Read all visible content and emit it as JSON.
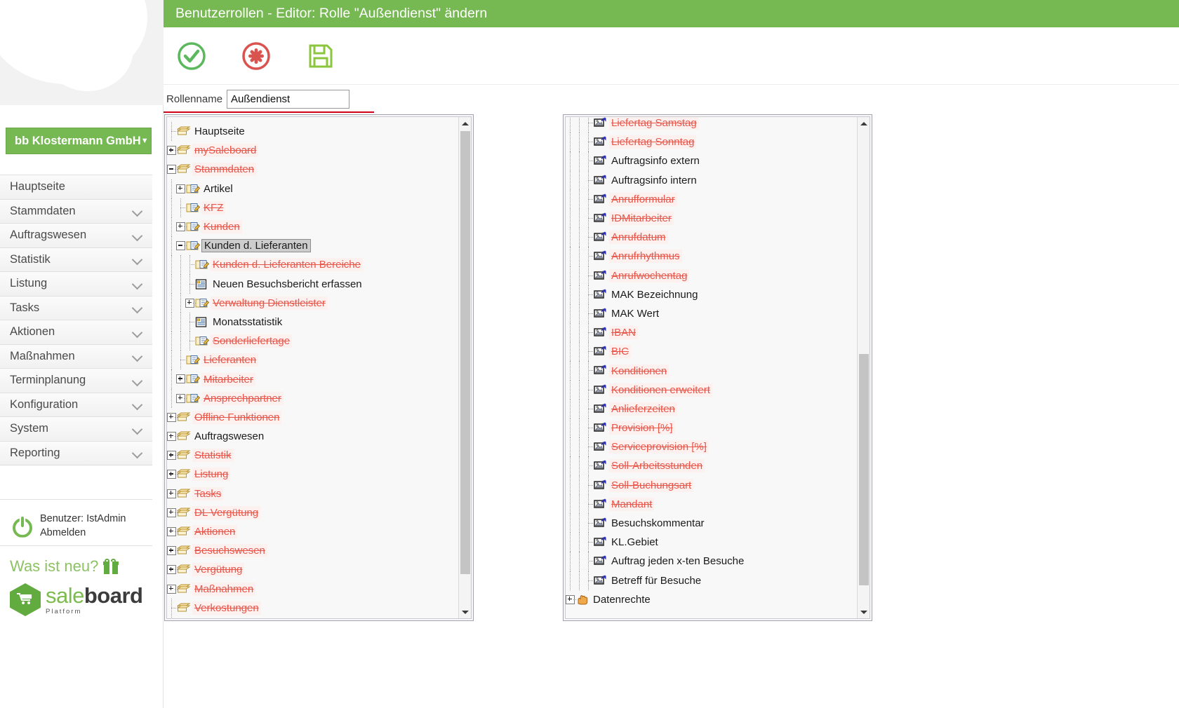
{
  "titlebar": {
    "title": "Benutzerrollen - Editor: Rolle \"Außendienst\" ändern"
  },
  "toolbar": {
    "ok_label": "check-circle",
    "cancel_label": "cancel-circle",
    "save_label": "floppy-disk"
  },
  "form": {
    "rolename_label": "Rollenname",
    "rolename_value": "Außendienst",
    "rolename_placeholder": ""
  },
  "sidebar": {
    "company": "bb Klostermann GmbH",
    "caret": "▼",
    "items": [
      {
        "label": "Hauptseite",
        "has_chevron": false
      },
      {
        "label": "Stammdaten",
        "has_chevron": true
      },
      {
        "label": "Auftragswesen",
        "has_chevron": true
      },
      {
        "label": "Statistik",
        "has_chevron": true
      },
      {
        "label": "Listung",
        "has_chevron": true
      },
      {
        "label": "Tasks",
        "has_chevron": true
      },
      {
        "label": "Aktionen",
        "has_chevron": true
      },
      {
        "label": "Maßnahmen",
        "has_chevron": true
      },
      {
        "label": "Terminplanung",
        "has_chevron": true
      },
      {
        "label": "Konfiguration",
        "has_chevron": true
      },
      {
        "label": "System",
        "has_chevron": true
      },
      {
        "label": "Reporting",
        "has_chevron": true
      }
    ],
    "user_line1": "Benutzer: IstAdmin",
    "user_line2": "Abmelden",
    "news_label": "Was ist neu?",
    "logo_sale": "sale",
    "logo_board": "board",
    "logo_sub": "Platform"
  },
  "left_tree": {
    "nodes": [
      {
        "label": "Hauptseite",
        "depth": 0,
        "exp": "none",
        "icon": "folder-stack",
        "denied": false,
        "selected": false
      },
      {
        "label": "mySaleboard",
        "depth": 0,
        "exp": "plus",
        "icon": "folder-stack",
        "denied": true,
        "selected": false
      },
      {
        "label": "Stammdaten",
        "depth": 0,
        "exp": "minus",
        "icon": "folder-stack",
        "denied": true,
        "selected": false
      },
      {
        "label": "Artikel",
        "depth": 1,
        "exp": "plus",
        "icon": "folder-page",
        "denied": false,
        "selected": false
      },
      {
        "label": "KFZ",
        "depth": 1,
        "exp": "none",
        "icon": "folder-page",
        "denied": true,
        "selected": false
      },
      {
        "label": "Kunden",
        "depth": 1,
        "exp": "plus",
        "icon": "folder-page",
        "denied": true,
        "selected": false
      },
      {
        "label": "Kunden d. Lieferanten",
        "depth": 1,
        "exp": "minus",
        "icon": "folder-page",
        "denied": false,
        "selected": true
      },
      {
        "label": "Kunden d. Lieferanten Bereiche",
        "depth": 2,
        "exp": "none",
        "icon": "folder-page",
        "denied": true,
        "selected": false
      },
      {
        "label": "Neuen Besuchsbericht erfassen",
        "depth": 2,
        "exp": "none",
        "icon": "form",
        "denied": false,
        "selected": false
      },
      {
        "label": "Verwaltung Dienstleister",
        "depth": 2,
        "exp": "plus",
        "icon": "folder-page",
        "denied": true,
        "selected": false
      },
      {
        "label": "Monatsstatistik",
        "depth": 2,
        "exp": "none",
        "icon": "form",
        "denied": false,
        "selected": false
      },
      {
        "label": "Sonderliefertage",
        "depth": 2,
        "exp": "none",
        "icon": "folder-page",
        "denied": true,
        "selected": false
      },
      {
        "label": "Lieferanten",
        "depth": 1,
        "exp": "none",
        "icon": "folder-page",
        "denied": true,
        "selected": false
      },
      {
        "label": "Mitarbeiter",
        "depth": 1,
        "exp": "plus",
        "icon": "folder-page",
        "denied": true,
        "selected": false
      },
      {
        "label": "Ansprechpartner",
        "depth": 1,
        "exp": "plus",
        "icon": "folder-page",
        "denied": true,
        "selected": false
      },
      {
        "label": "Offline Funktionen",
        "depth": 0,
        "exp": "plus",
        "icon": "folder-stack",
        "denied": true,
        "selected": false
      },
      {
        "label": "Auftragswesen",
        "depth": 0,
        "exp": "plus",
        "icon": "folder-stack",
        "denied": false,
        "selected": false
      },
      {
        "label": "Statistik",
        "depth": 0,
        "exp": "plus",
        "icon": "folder-stack",
        "denied": true,
        "selected": false
      },
      {
        "label": "Listung",
        "depth": 0,
        "exp": "plus",
        "icon": "folder-stack",
        "denied": true,
        "selected": false
      },
      {
        "label": "Tasks",
        "depth": 0,
        "exp": "plus",
        "icon": "folder-stack",
        "denied": true,
        "selected": false
      },
      {
        "label": "DL Vergütung",
        "depth": 0,
        "exp": "plus",
        "icon": "folder-stack",
        "denied": true,
        "selected": false
      },
      {
        "label": "Aktionen",
        "depth": 0,
        "exp": "plus",
        "icon": "folder-stack",
        "denied": true,
        "selected": false
      },
      {
        "label": "Besuchswesen",
        "depth": 0,
        "exp": "plus",
        "icon": "folder-stack",
        "denied": true,
        "selected": false
      },
      {
        "label": "Vergütung",
        "depth": 0,
        "exp": "plus",
        "icon": "folder-stack",
        "denied": true,
        "selected": false
      },
      {
        "label": "Maßnahmen",
        "depth": 0,
        "exp": "plus",
        "icon": "folder-stack",
        "denied": true,
        "selected": false
      },
      {
        "label": "Verkostungen",
        "depth": 0,
        "exp": "none",
        "icon": "folder-stack",
        "denied": true,
        "selected": false
      }
    ]
  },
  "right_tree": {
    "nodes": [
      {
        "label": "Liefertag Samstag",
        "depth": 2,
        "exp": "none",
        "icon": "property",
        "denied": true
      },
      {
        "label": "Liefertag Sonntag",
        "depth": 2,
        "exp": "none",
        "icon": "property",
        "denied": true
      },
      {
        "label": "Auftragsinfo extern",
        "depth": 2,
        "exp": "none",
        "icon": "property",
        "denied": false
      },
      {
        "label": "Auftragsinfo intern",
        "depth": 2,
        "exp": "none",
        "icon": "property",
        "denied": false
      },
      {
        "label": "Anrufformular",
        "depth": 2,
        "exp": "none",
        "icon": "property",
        "denied": true
      },
      {
        "label": "IDMitarbeiter",
        "depth": 2,
        "exp": "none",
        "icon": "property",
        "denied": true
      },
      {
        "label": "Anrufdatum",
        "depth": 2,
        "exp": "none",
        "icon": "property",
        "denied": true
      },
      {
        "label": "Anrufrhythmus",
        "depth": 2,
        "exp": "none",
        "icon": "property",
        "denied": true
      },
      {
        "label": "Anrufwochentag",
        "depth": 2,
        "exp": "none",
        "icon": "property",
        "denied": true
      },
      {
        "label": "MAK Bezeichnung",
        "depth": 2,
        "exp": "none",
        "icon": "property",
        "denied": false
      },
      {
        "label": "MAK Wert",
        "depth": 2,
        "exp": "none",
        "icon": "property",
        "denied": false
      },
      {
        "label": "IBAN",
        "depth": 2,
        "exp": "none",
        "icon": "property",
        "denied": true
      },
      {
        "label": "BIC",
        "depth": 2,
        "exp": "none",
        "icon": "property",
        "denied": true
      },
      {
        "label": "Konditionen",
        "depth": 2,
        "exp": "none",
        "icon": "property",
        "denied": true
      },
      {
        "label": "Konditionen erweitert",
        "depth": 2,
        "exp": "none",
        "icon": "property",
        "denied": true
      },
      {
        "label": "Anlieferzeiten",
        "depth": 2,
        "exp": "none",
        "icon": "property",
        "denied": true
      },
      {
        "label": "Provision [%]",
        "depth": 2,
        "exp": "none",
        "icon": "property",
        "denied": true
      },
      {
        "label": "Serviceprovision [%]",
        "depth": 2,
        "exp": "none",
        "icon": "property",
        "denied": true
      },
      {
        "label": "Soll-Arbeitsstunden",
        "depth": 2,
        "exp": "none",
        "icon": "property",
        "denied": true
      },
      {
        "label": "Soll-Buchungsart",
        "depth": 2,
        "exp": "none",
        "icon": "property",
        "denied": true
      },
      {
        "label": "Mandant",
        "depth": 2,
        "exp": "none",
        "icon": "property",
        "denied": true
      },
      {
        "label": "Besuchskommentar",
        "depth": 2,
        "exp": "none",
        "icon": "property",
        "denied": false
      },
      {
        "label": "KL.Gebiet",
        "depth": 2,
        "exp": "none",
        "icon": "property",
        "denied": false
      },
      {
        "label": "Auftrag jeden x-ten Besuche",
        "depth": 2,
        "exp": "none",
        "icon": "property",
        "denied": false
      },
      {
        "label": "Betreff für Besuche",
        "depth": 2,
        "exp": "none",
        "icon": "property",
        "denied": false
      },
      {
        "label": "Datenrechte",
        "depth": 0,
        "exp": "plus",
        "icon": "hand",
        "denied": false
      }
    ]
  },
  "scrollbars": {
    "up_arrow": "▲",
    "down_arrow": "▼"
  },
  "colors": {
    "brand_green": "#76b852",
    "denied_red": "#e8564a",
    "accent_red": "#d0021b"
  }
}
